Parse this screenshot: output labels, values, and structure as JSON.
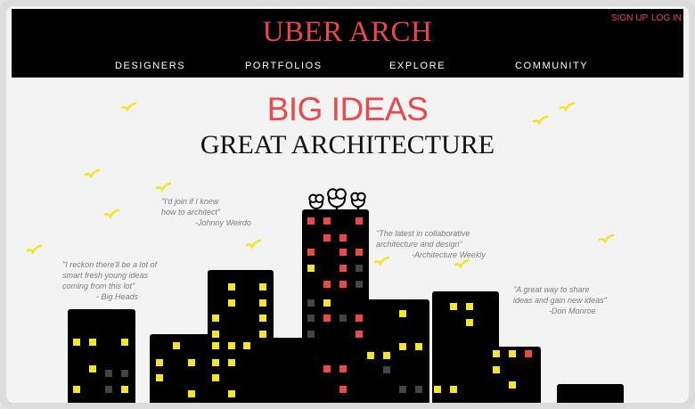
{
  "header": {
    "logo": "UBER ARCH",
    "sign_up": "SIGN UP",
    "log_in": "LOG IN",
    "nav": [
      "DESIGNERS",
      "PORTFOLIOS",
      "EXPLORE",
      "COMMUNITY"
    ]
  },
  "hero": {
    "headline": "BIG IDEAS",
    "subheadline": "GREAT ARCHITECTURE"
  },
  "quotes": [
    {
      "text": "\"I'd join if I knew\nhow to architect\"",
      "author": "-Johnny Weirdo"
    },
    {
      "text": "\"I reckon there'll be a lot of\nsmart fresh young ideas\ncoming from this lot\"",
      "author": "- Big Heads"
    },
    {
      "text": "\"The latest in collaborative\narchitecture and design\"",
      "author": "-Architecture Weekly"
    },
    {
      "text": "\"A great way to share\nideas and gain new ideas\"",
      "author": "-Don Monroe"
    }
  ],
  "colors": {
    "accent": "#e8494a",
    "header_bg": "#000000",
    "window_yellow": "#f5e52a",
    "window_red": "#e8494a",
    "window_gray": "#444444",
    "bird": "#f5e52a"
  },
  "icons": [
    "bird-icon",
    "tree-icon"
  ]
}
